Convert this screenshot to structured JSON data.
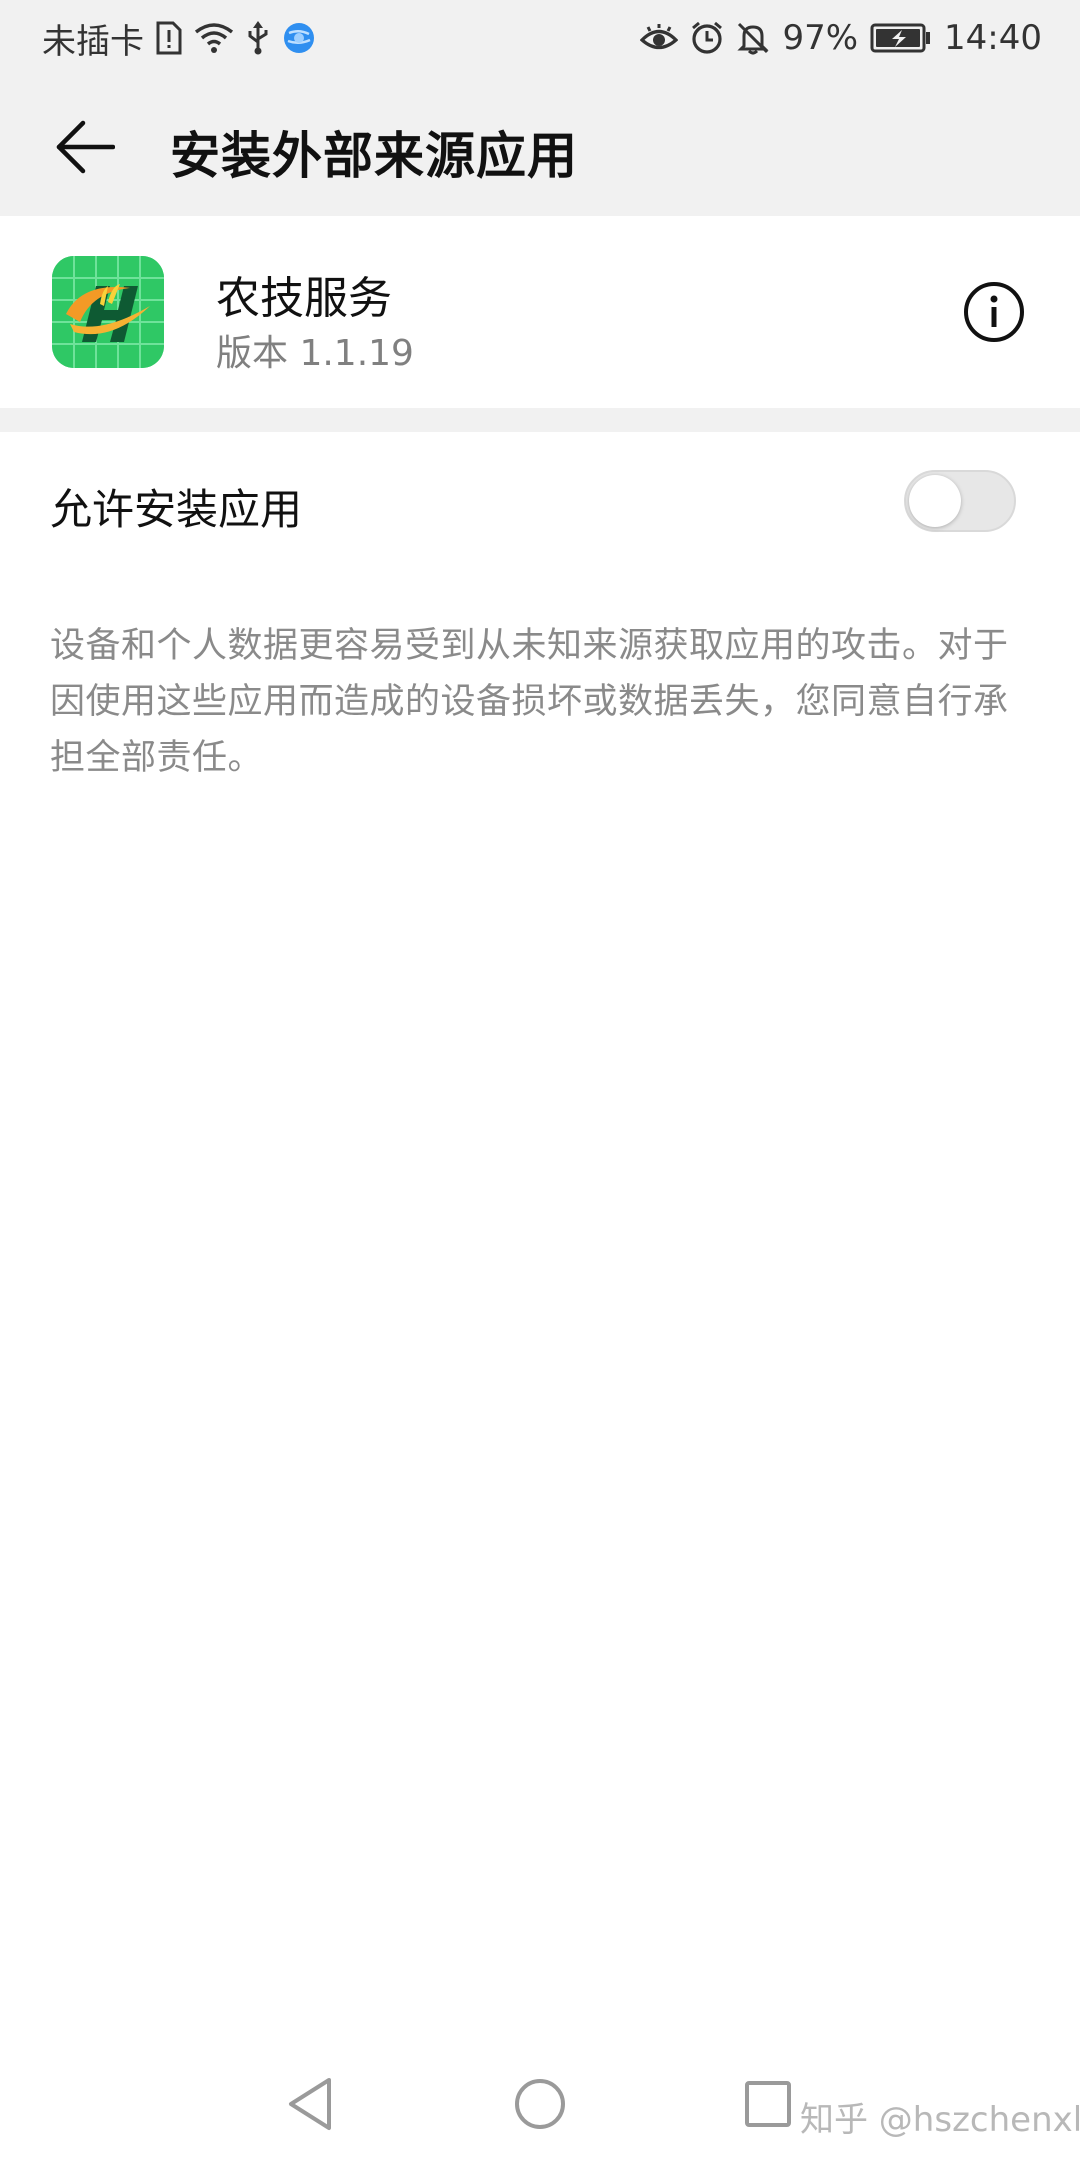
{
  "status_bar": {
    "carrier": "未插卡",
    "battery_percent": "97%",
    "time": "14:40",
    "left_icons": [
      "sim-alert-icon",
      "wifi-icon",
      "usb-icon",
      "browser-icon"
    ],
    "right_icons": [
      "eye-icon",
      "alarm-icon",
      "mute-bell-icon",
      "battery-charging-icon"
    ]
  },
  "header": {
    "title": "安装外部来源应用",
    "back_icon": "arrow-left-icon"
  },
  "app": {
    "name": "农技服务",
    "version": "版本 1.1.19",
    "icon_color": "#2fc865",
    "info_icon": "info-icon"
  },
  "setting": {
    "label": "允许安装应用",
    "enabled": false
  },
  "warning": {
    "text": "设备和个人数据更容易受到从未知来源获取应用的攻击。对于因使用这些应用而造成的设备损坏或数据丢失，您同意自行承担全部责任。"
  },
  "navigation": {
    "icons": [
      "nav-back-icon",
      "nav-home-icon",
      "nav-recent-icon"
    ]
  },
  "watermark": "知乎 @hszchenxl"
}
